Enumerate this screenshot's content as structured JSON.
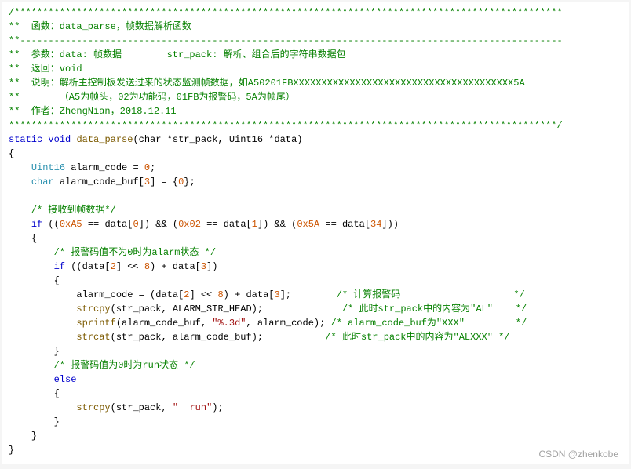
{
  "comment": {
    "stars_open": "/*************************************************************************************************",
    "l1": "**  函数：data_parse，帧数据解析函数",
    "stars_mid": "**------------------------------------------------------------------------------------------------",
    "l2": "**  参数：data: 帧数据        str_pack: 解析、组合后的字符串数据包",
    "l3": "**  返回：void",
    "l4": "**  说明：解析主控制板发送过来的状态监测帧数据，如A50201FBXXXXXXXXXXXXXXXXXXXXXXXXXXXXXXXXXXXXXXX5A",
    "l5": "**       （A5为帧头，02为功能码，01FB为报警码，5A为帧尾）",
    "l6": "**  作者：ZhengNian，2018.12.11",
    "stars_close": "*************************************************************************************************/"
  },
  "sig": {
    "static": "static",
    "void": "void",
    "name": "data_parse",
    "params": "(char *str_pack, Uint16 *data)"
  },
  "body": {
    "decl1_type": "Uint16",
    "decl1_rest": "alarm_code = ",
    "zero": "0",
    "semi": ";",
    "decl2_type": "char",
    "decl2_rest": "alarm_code_buf[",
    "three": "3",
    "decl2_init": "] = {",
    "decl2_end": "};",
    "c_recv": "/* 接收到帧数据*/",
    "if_kw": "if",
    "cond_open": " ((",
    "hexA5": "0xA5",
    "eq": " == ",
    "data0": "data[",
    "idx0": "0",
    "br_close": "]",
    "and": ") && (",
    "hex02": "0x02",
    "idx1": "1",
    "hex5A": "0x5A",
    "idx34": "34",
    "cond_close": "]))",
    "lbr": "{",
    "rbr": "}",
    "c_notzero": "/* 报警码值不为0时为alarm状态 */",
    "cond2_open": " ((data[",
    "idx2": "2",
    "shift": "] << ",
    "eight": "8",
    "plus": ") + data[",
    "idx3": "3",
    "cond2_close": "])",
    "assign": "alarm_code = (data[",
    "assign_end": "];",
    "c_calc": "/* 计算报警码                    */",
    "strcpy": "strcpy",
    "call1_args": "(str_pack, ALARM_STR_HEAD);",
    "c_al": "/* 此时str_pack中的内容为\"AL\"    */",
    "sprintf": "sprintf",
    "call2_pre": "(alarm_code_buf, ",
    "fmt": "\"%.3d\"",
    "call2_post": ", alarm_code);",
    "c_xxx": "/* alarm_code_buf为\"XXX\"         */",
    "strcat": "strcat",
    "call3_args": "(str_pack, alarm_code_buf);",
    "c_alxxx": "/* 此时str_pack中的内容为\"ALXXX\" */",
    "c_zero": "/* 报警码值为0时为run状态 */",
    "else": "else",
    "call4_pre": "(str_pack, ",
    "run": "\"  run\"",
    "call4_post": ");"
  },
  "watermark": "CSDN @zhenkobe"
}
